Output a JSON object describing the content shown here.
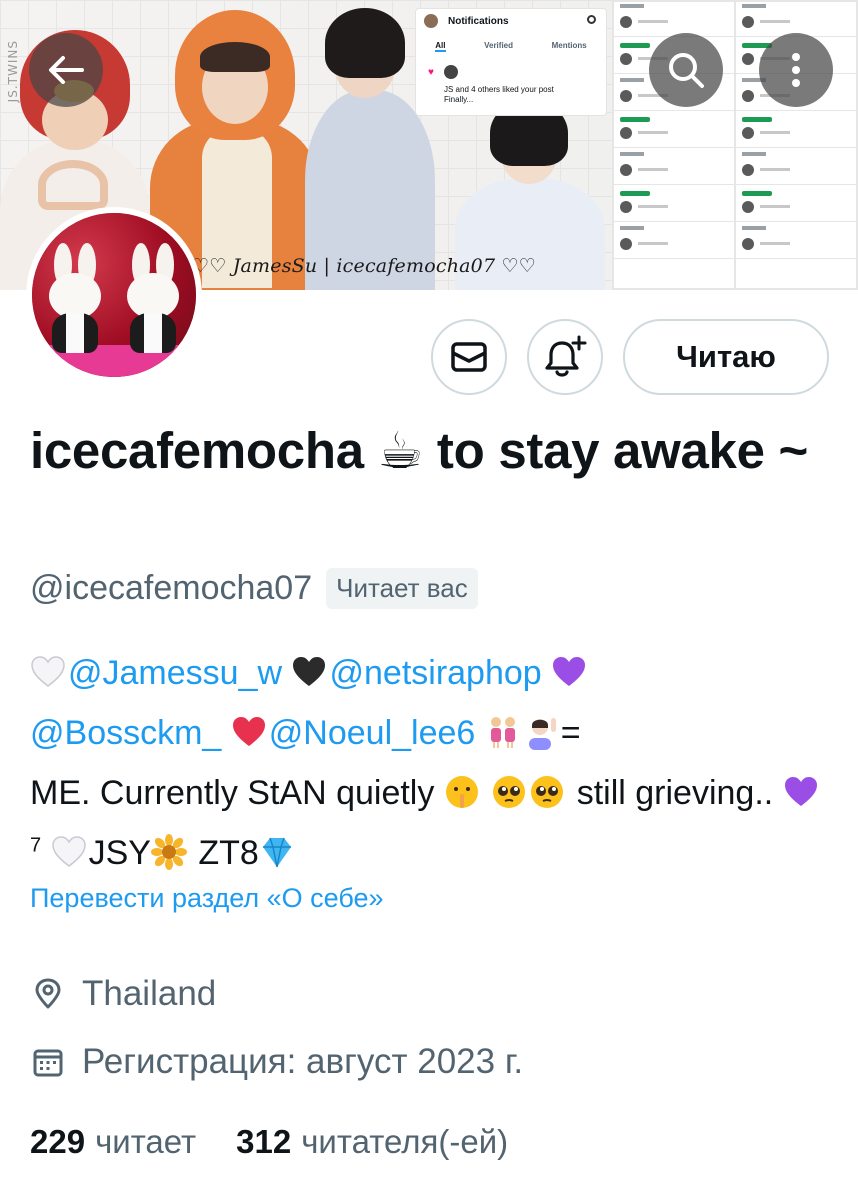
{
  "banner": {
    "watermark": "JS.TWINS",
    "caption": "♡♡ JamesSu | icecafemocha07 ♡♡",
    "notifications_card": {
      "title": "Notifications",
      "tabs": [
        "All",
        "Verified",
        "Mentions"
      ],
      "text_line1": "JS and 4 others liked your post",
      "text_line2": "Finally..."
    }
  },
  "profile": {
    "display_name": "icecafemocha ☕ to stay awake ~",
    "handle": "@icecafemocha07",
    "follows_you_badge": "Читает вас",
    "follow_button": "Читаю",
    "bio": {
      "mention1": "@Jamessu_w",
      "mention2": "@netsiraphop",
      "mention3": "@Bossckm_",
      "mention4": "@Noeul_lee6",
      "text1": "=",
      "text2": "ME. Currently StAN quietly",
      "text3": "still grieving..",
      "sup": "7",
      "text4": "JSY",
      "text5": "ZT8"
    },
    "translate_link": "Перевести раздел «О себе»",
    "location": "Thailand",
    "joined": "Регистрация: август 2023 г.",
    "following_count": "229",
    "following_label": "читает",
    "followers_count": "312",
    "followers_label": "читателя(-ей)"
  },
  "icons": {
    "back": "back-arrow-icon",
    "search": "search-icon",
    "more": "more-vertical-icon",
    "message": "envelope-icon",
    "notify": "bell-plus-icon",
    "location": "location-pin-icon",
    "calendar": "calendar-icon"
  },
  "colors": {
    "link": "#1d9bf0",
    "secondary_text": "#536471",
    "border": "#cfd9de",
    "primary_text": "#0f1419"
  }
}
